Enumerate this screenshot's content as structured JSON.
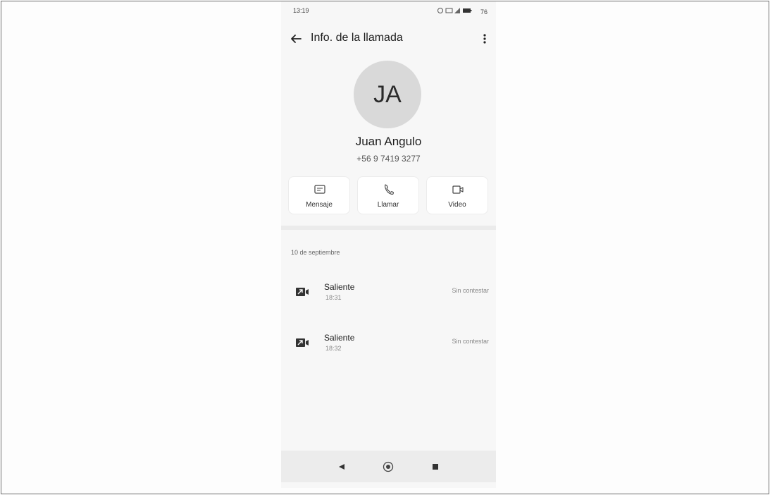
{
  "status_bar": {
    "time": "13:19",
    "battery": "76"
  },
  "app_bar": {
    "title": "Info. de la llamada"
  },
  "contact": {
    "initials": "JA",
    "name": "Juan Angulo",
    "number": "+56 9 7419 3277"
  },
  "actions": [
    {
      "label": "Mensaje",
      "icon": "message-icon"
    },
    {
      "label": "Llamar",
      "icon": "phone-icon"
    },
    {
      "label": "Video",
      "icon": "video-icon"
    }
  ],
  "history": {
    "date": "10 de septiembre",
    "calls": [
      {
        "type": "Saliente",
        "time": "18:31",
        "result": "Sin contestar",
        "icon": "outgoing-video-call-icon"
      },
      {
        "type": "Saliente",
        "time": "18:32",
        "result": "Sin contestar",
        "icon": "outgoing-video-call-icon"
      }
    ]
  },
  "nav_bar": {
    "icons": [
      "back-triangle-icon",
      "home-circle-icon",
      "recents-square-icon"
    ]
  },
  "colors": {
    "phone_background": "#f7f7f7",
    "avatar_background": "#d9d9d9",
    "nav_background": "#ececec"
  }
}
